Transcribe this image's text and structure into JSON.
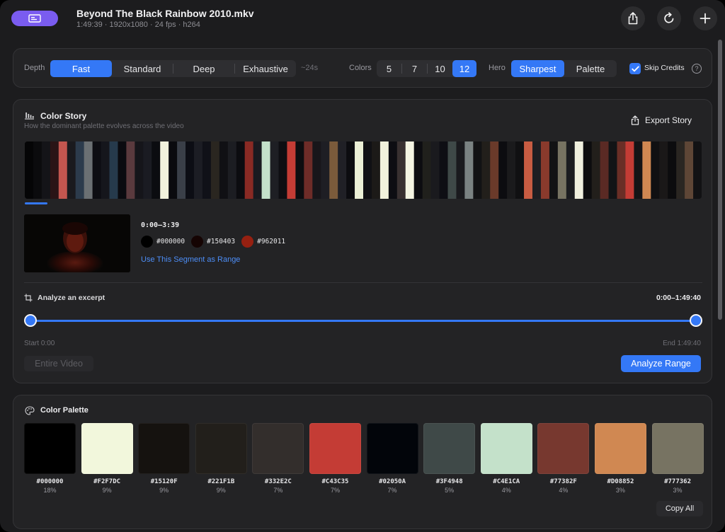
{
  "window": {
    "title": "Beyond The Black Rainbow 2010.mkv",
    "subtitle": "1:49:39 · 1920x1080 · 24 fps · h264",
    "app_icon": "app-window-icon",
    "actions": [
      {
        "name": "share-button",
        "icon": "share-icon"
      },
      {
        "name": "refresh-button",
        "icon": "refresh-icon"
      },
      {
        "name": "add-button",
        "icon": "plus-icon"
      }
    ]
  },
  "options": {
    "depth_label": "Depth",
    "depth_options": [
      "Fast",
      "Standard",
      "Deep",
      "Exhaustive"
    ],
    "depth_selected": "Fast",
    "depth_estimate": "~24s",
    "colors_label": "Colors",
    "colors_options": [
      "5",
      "7",
      "10",
      "12"
    ],
    "colors_selected": "12",
    "hero_label": "Hero",
    "hero_options": [
      "Sharpest",
      "Palette"
    ],
    "hero_selected": "Sharpest",
    "skip_credits_label": "Skip Credits",
    "skip_credits_checked": true,
    "help_glyph": "?"
  },
  "story": {
    "title": "Color Story",
    "description": "How the dominant palette evolves across the video",
    "export_label": "Export Story",
    "strip_colors": [
      "#050506",
      "#0b0b0d",
      "#141418",
      "#2a1416",
      "#c4564f",
      "#1a1a1e",
      "#2c3b4c",
      "#6b7073",
      "#0d0d12",
      "#15161c",
      "#263a4c",
      "#0a0b10",
      "#5a3a3e",
      "#15151a",
      "#1a1b22",
      "#0b0c10",
      "#f2f2dc",
      "#0a0a0e",
      "#3a3f48",
      "#0c0d14",
      "#1c1d24",
      "#101118",
      "#2a2620",
      "#101014",
      "#1c1d22",
      "#0c0c10",
      "#8a2a24",
      "#1a1a20",
      "#c4e1ca",
      "#1e1f24",
      "#0e0e12",
      "#c43c35",
      "#0d0d10",
      "#6e2c28",
      "#18161a",
      "#1e1e24",
      "#7b5b3b",
      "#202026",
      "#0c0c10",
      "#ebefd6",
      "#101014",
      "#1c1a18",
      "#f2f2dc",
      "#0d0d12",
      "#383030",
      "#f4f4e2",
      "#0c0c10",
      "#20201c",
      "#1a1a1e",
      "#0e0e14",
      "#3f4948",
      "#1a1a1e",
      "#7a8282",
      "#121214",
      "#221f1b",
      "#6a3a2a",
      "#0c0c10",
      "#1a1a1c",
      "#101012",
      "#c85c42",
      "#1e1e22",
      "#8a3a2c",
      "#121214",
      "#777362",
      "#1b1c20",
      "#efefde",
      "#0c0c0e",
      "#221f1b",
      "#5a2a24",
      "#121416",
      "#6a2e26",
      "#c43c35",
      "#141416",
      "#d08852",
      "#101012",
      "#1a1818",
      "#0c0c0e",
      "#2a2622",
      "#5e4636",
      "#121214"
    ],
    "segment_time": "0:00–3:39",
    "segment_colors": [
      {
        "color": "#000000",
        "hex": "#000000"
      },
      {
        "color": "#150403",
        "hex": "#150403"
      },
      {
        "color": "#962011",
        "hex": "#962011"
      }
    ],
    "use_segment_label": "Use This Segment as Range",
    "excerpt_title": "Analyze an excerpt",
    "excerpt_range": "0:00–1:49:40",
    "excerpt_start_fraction": 0,
    "excerpt_end_fraction": 1,
    "start_label": "Start 0:00",
    "end_label": "End 1:49:40",
    "entire_video_label": "Entire Video",
    "analyze_range_label": "Analyze Range"
  },
  "palette": {
    "title": "Color Palette",
    "swatches": [
      {
        "color": "#000000",
        "hex": "#000000",
        "pct": "18%"
      },
      {
        "color": "#F2F7DC",
        "hex": "#F2F7DC",
        "pct": "9%"
      },
      {
        "color": "#15120F",
        "hex": "#15120F",
        "pct": "9%"
      },
      {
        "color": "#221F1B",
        "hex": "#221F1B",
        "pct": "9%"
      },
      {
        "color": "#332E2C",
        "hex": "#332E2C",
        "pct": "7%"
      },
      {
        "color": "#C43C35",
        "hex": "#C43C35",
        "pct": "7%"
      },
      {
        "color": "#02050A",
        "hex": "#02050A",
        "pct": "7%"
      },
      {
        "color": "#3F4948",
        "hex": "#3F4948",
        "pct": "5%"
      },
      {
        "color": "#C4E1CA",
        "hex": "#C4E1CA",
        "pct": "4%"
      },
      {
        "color": "#77382F",
        "hex": "#77382F",
        "pct": "4%"
      },
      {
        "color": "#D08852",
        "hex": "#D08852",
        "pct": "3%"
      },
      {
        "color": "#777362",
        "hex": "#777362",
        "pct": "3%"
      }
    ],
    "copy_all_label": "Copy All"
  },
  "accent": "#3478f6"
}
